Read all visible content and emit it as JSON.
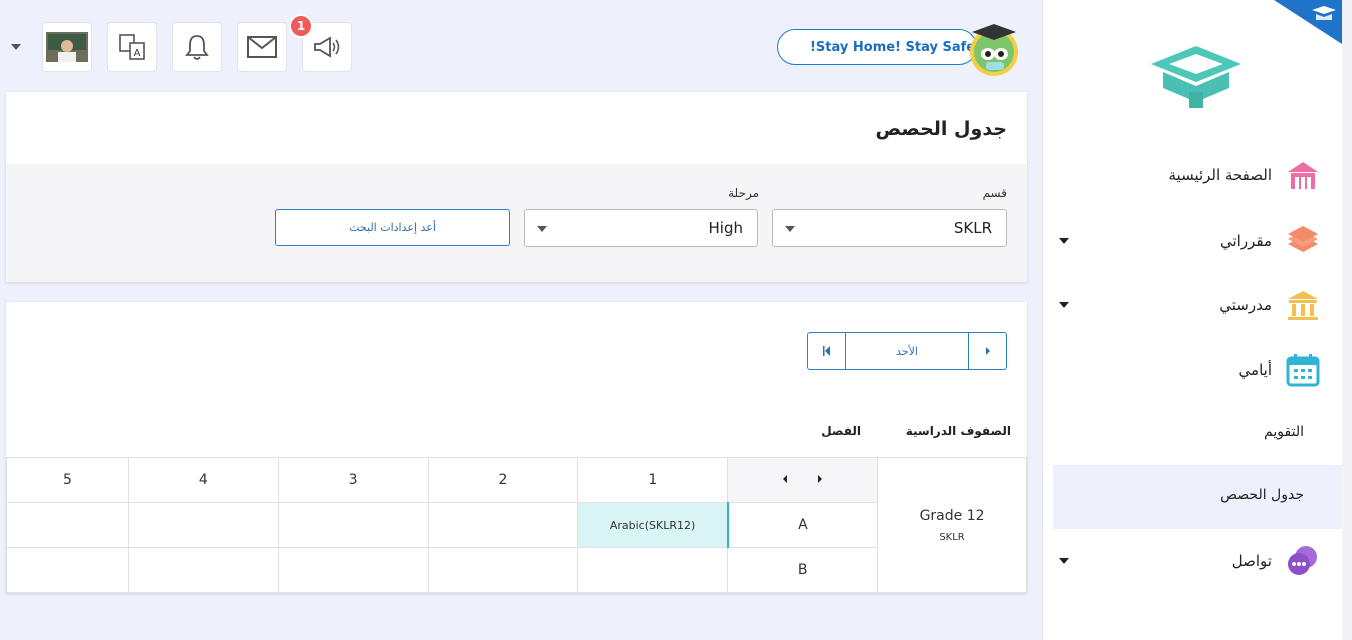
{
  "header": {
    "banner_text": "!Stay Home! Stay Safe",
    "notification_count": "1",
    "icons": [
      "user-avatar-icon",
      "translate-icon",
      "bell-icon",
      "mail-icon",
      "megaphone-icon"
    ]
  },
  "sidebar": {
    "items": [
      {
        "label": "الصفحة الرئيسية",
        "icon": "home-icon"
      },
      {
        "label": "مقرراتي",
        "icon": "books-icon",
        "has_dropdown": true
      },
      {
        "label": "مدرستي",
        "icon": "school-icon",
        "has_dropdown": true
      },
      {
        "label": "أيامي",
        "icon": "calendar-icon"
      },
      {
        "label": "التقويم"
      },
      {
        "label": "جدول الحصص",
        "active": true
      },
      {
        "label": "تواصل",
        "icon": "chat-icon",
        "has_dropdown": true
      }
    ]
  },
  "page": {
    "title": "جدول الحصص",
    "filters": {
      "section_label": "قسم",
      "section_value": "SKLR",
      "stage_label": "مرحلة",
      "stage_value": "High",
      "reset_label": "أعد إعدادات البحث"
    },
    "day_nav": {
      "day": "الأحد"
    },
    "table": {
      "col_grades": "الصفوف الدراسية",
      "col_class": "الفصل",
      "periods": [
        "1",
        "2",
        "3",
        "4",
        "5"
      ],
      "grade_name": "Grade 12",
      "grade_sub": "SKLR",
      "rows": [
        {
          "section": "A",
          "cells": [
            "Arabic(SKLR12)",
            "",
            "",
            "",
            ""
          ]
        },
        {
          "section": "B",
          "cells": [
            "",
            "",
            "",
            "",
            ""
          ]
        }
      ]
    }
  },
  "colors": {
    "accent": "#2f7fc4",
    "highlight": "#d9f4f4",
    "badge": "#f05a5a",
    "background": "#eef0fb"
  }
}
